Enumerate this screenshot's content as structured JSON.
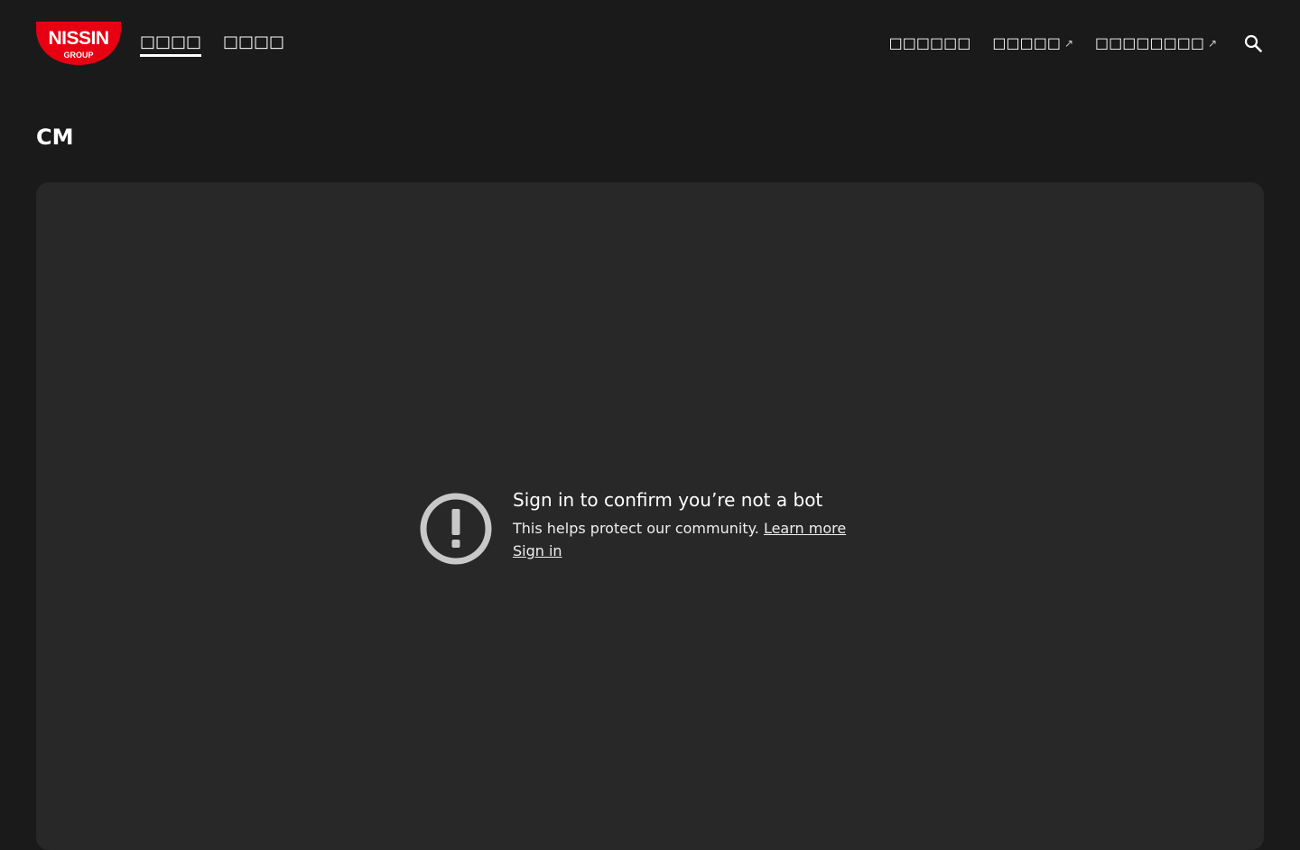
{
  "header": {
    "logo": {
      "main_text": "NISSIN",
      "sub_text": "GROUP",
      "color": "#e60012"
    },
    "nav_left": [
      {
        "label": "□□□□",
        "active": true
      },
      {
        "label": "□□□□",
        "active": false
      }
    ],
    "nav_right": [
      {
        "label": "□□□□□□",
        "external": false
      },
      {
        "label": "□□□□□",
        "external": true
      },
      {
        "label": "□□□□□□□□",
        "external": true
      }
    ],
    "external_icon": "↗",
    "search_icon": "search-icon"
  },
  "page": {
    "title": "CM"
  },
  "video": {
    "heading": "Sign in to confirm you’re not a bot",
    "body": "This helps protect our community.",
    "learn_more": "Learn more",
    "sign_in": "Sign in",
    "icon": "alert-circle-icon",
    "panel_color": "#282828"
  }
}
